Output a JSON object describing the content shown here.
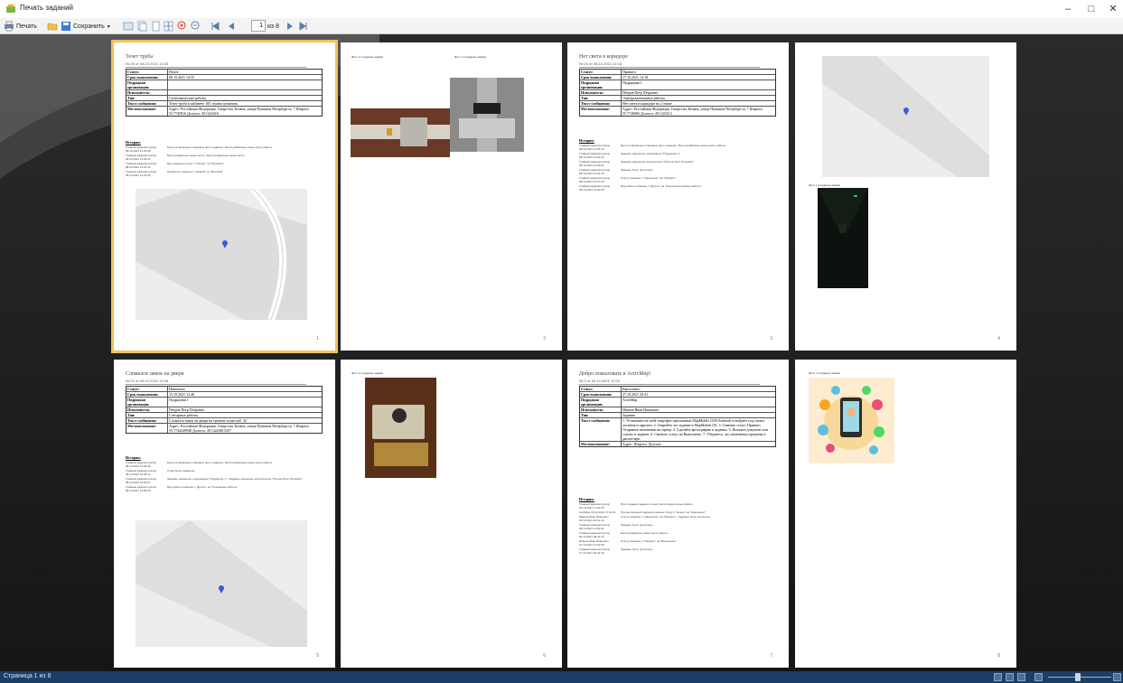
{
  "window": {
    "title": "Печать заданий",
    "controls": {
      "minimize": "–",
      "maximize": "□",
      "close": "✕"
    }
  },
  "toolbar": {
    "print_label": "Печать",
    "save_label": "Сохранить",
    "page_input": "1",
    "page_of": "из 8",
    "icons": [
      "printer-icon",
      "open-folder-icon",
      "save-icon",
      "dropdown-arrow-icon",
      "export-icon",
      "copy-icon",
      "single-page-icon",
      "multi-page-icon",
      "zoom-in-icon",
      "zoom-out-icon",
      "first-page-icon",
      "prev-page-icon",
      "next-page-icon",
      "last-page-icon"
    ]
  },
  "pages": [
    {
      "number": "1",
      "title": "Течет труба",
      "subtitle": "№ 25 от 08.10.2021 14:35",
      "rows": [
        {
          "k": "Статус:",
          "v": "Новое"
        },
        {
          "k": "Срок выполнения:",
          "v": "08.10.2021 14:35"
        },
        {
          "k": "Подрядная организация:",
          "v": ""
        },
        {
          "k": "Исполнитель:",
          "v": ""
        },
        {
          "k": "Тип:",
          "v": "Сантехнические работы"
        },
        {
          "k": "Текст сообщения:",
          "v": "Течет труба в кабинете 105, нужно починить"
        },
        {
          "k": "Местоположение:",
          "v": "Адрес: Российская Федерация, Татарстан, Казань, улица Пушкина Петербургск. 7 Широта: 55.7745816 Долгота: 49.1424416"
        }
      ],
      "history_head": "История:",
      "history": [
        {
          "k": "Главный администратор 08.10.2021 14:35:09",
          "v": "Были установлены плановые фото задания • Были добавлены новые фото работы"
        },
        {
          "k": "Главный администратор 08.10.2021 14:40:31",
          "v": "Были добавлены новые фото • Были добавлены новые фото"
        },
        {
          "k": "Главный администратор 08.10.2021 14:41:12",
          "v": "Был изменен статус с \"Принят\" на \"В работе\""
        },
        {
          "k": "Главный администратор 08.10.2021 14:44:56",
          "v": "Приоритет изменен с \"Низкий\" на \"Высокий\""
        }
      ]
    },
    {
      "number": "2",
      "photo_label_1": "Фото 1 (создание заявки)",
      "photo_label_2": "Фото 2 (создание заявки)"
    },
    {
      "number": "3",
      "title": "Нет света в коридоре",
      "subtitle": "№ 24 от 08.10.2021 14:18",
      "rows": [
        {
          "k": "Статус:",
          "v": "Принято"
        },
        {
          "k": "Срок выполнения:",
          "v": "27.10.2021 14:18"
        },
        {
          "k": "Подрядная организация:",
          "v": "Подрядчик 1"
        },
        {
          "k": "Исполнитель:",
          "v": "Петров Петр Петрович"
        },
        {
          "k": "Тип:",
          "v": "Электромонтажные работы"
        },
        {
          "k": "Текст сообщения:",
          "v": "Нет света в коридоре на 2 этаже"
        },
        {
          "k": "Местоположение:",
          "v": "Адрес: Российская Федерация, Татарстан, Казань, улица Пушкина Петербургск. 7 Широта: 55.7746006 Долгота: 49.1423212"
        }
      ],
      "history_head": "История:",
      "history": [
        {
          "k": "Главный администратор 08.10.2021 14:18:19",
          "v": "Были установлены плановые фото задания • Были добавлены новые фото работы"
        },
        {
          "k": "Главный администратор 08.10.2021 14:19:44",
          "v": "Задание назначено организации \"Подрядчик 1\""
        },
        {
          "k": "Главный администратор 08.10.2021 14:20:01",
          "v": "Задание назначено исполнителю \"Петров Петр Петрович\""
        },
        {
          "k": "Главный администратор 08.10.2021 14:21:15",
          "v": "Задание было прочитано"
        },
        {
          "k": "Главный администратор 08.10.2021 14:27:20",
          "v": "Статус изменен с \"Назначено\" на \"Принято\""
        },
        {
          "k": "Главный администратор 08.10.2021 14:30:08",
          "v": "Вид работы изменен с \"Другое\" на \"Электромонтажные работы\""
        }
      ]
    },
    {
      "number": "4",
      "photo_label": "Фото 1 (создание заявки)"
    },
    {
      "number": "5",
      "title": "Сломался замок на двери",
      "subtitle": "№ 22 от 08.10.2021 13:46",
      "rows": [
        {
          "k": "Статус:",
          "v": "Назначено"
        },
        {
          "k": "Срок выполнения:",
          "v": "15.10.2021 13:46"
        },
        {
          "k": "Подрядная организация:",
          "v": "Подрядчик 1"
        },
        {
          "k": "Исполнитель:",
          "v": "Петров Петр Петрович"
        },
        {
          "k": "Тип:",
          "v": "Слесарные работы"
        },
        {
          "k": "Текст сообщения:",
          "v": "Сломался замок на двери на третьем этаже каб. 32"
        },
        {
          "k": "Местоположение:",
          "v": "Адрес: Российская Федерация, Татарстан, Казань, улица Пушкина Петербургск. 7 Широта: 55.7744249948 Долгота: 49.14224813357"
        }
      ],
      "history_head": "История:",
      "history": [
        {
          "k": "Главный администратор 08.10.2021 13:46:35",
          "v": "Были установлены плановые фото задания • Были добавлены новые фото работы"
        },
        {
          "k": "Главный администратор 08.10.2021 13:48:12",
          "v": "Точка была заменена"
        },
        {
          "k": "Главный администратор 08.10.2021 13:50:27",
          "v": "Задание назначено организации \"Подрядчик 1\" • Задание назначено исполнителю \"Петров Петр Петрович\""
        },
        {
          "k": "Главный администратор 08.10.2021 13:55:03",
          "v": "Вид работы изменен с \"Другое\" на \"Слесарные работы\""
        }
      ]
    },
    {
      "number": "6",
      "photo_label": "Фото 1 (создание заявки)"
    },
    {
      "number": "7",
      "title": "Добро пожаловать в ActivMap!",
      "subtitle": "№ 3 от 04.10.2021 17:00",
      "rows": [
        {
          "k": "Статус:",
          "v": "Выполнено"
        },
        {
          "k": "Срок выполнения:",
          "v": "27.10.2021 20:41"
        },
        {
          "k": "Подрядная организация:",
          "v": "ActivMap"
        },
        {
          "k": "Исполнитель:",
          "v": "Иванов Иван Иванович"
        },
        {
          "k": "Тип:",
          "v": "Задание"
        },
        {
          "k": "Текст сообщения:",
          "v": "1. Установите на свой смартфон приложение MapMobile (iOS/Android) и войдите под своим логином и паролем. 2. Откройте это задание в MapMobile OS. 3. Смените статус Принято. Отправьте изменения на сервер. 4. Сделайте фотографию в задании. 5. Вложите документ или ссылку в задание. 6. Смените статус на Выполнено. 7. Убедитесь, что изменения отражены в диспетчере."
        },
        {
          "k": "Местоположение:",
          "v": "Адрес: Широта: Долгота:"
        }
      ],
      "history_head": "История:",
      "history": [
        {
          "k": "Главный администратор 04.10.2021 17:00:36",
          "v": "При создании задания к нему были прикреплены файлы"
        },
        {
          "k": "ActivMap 04.10.2021 17:04:21",
          "v": "При выполнении задания изменен статус с \"Новое\" на \"Назначено\""
        },
        {
          "k": "Иванов Иван Иванович 05.10.2021 10:12:44",
          "v": "Статус изменен с \"Назначено\" на \"Принято\" • Задание было прочитано"
        },
        {
          "k": "Главный администратор 05.10.2021 11:30:02",
          "v": "Задание было прочитано"
        },
        {
          "k": "Главный администратор 06.10.2021 09:41:17",
          "v": "Были добавлены новые фото работы"
        },
        {
          "k": "Иванов Иван Иванович 07.10.2021 14:22:05",
          "v": "Статус изменен с \"Принято\" на \"Выполнено\""
        },
        {
          "k": "Главный администратор 27.10.2021 20:41:33",
          "v": "Задание было прочитано"
        }
      ]
    },
    {
      "number": "8",
      "photo_label": "Фото 1 (создание заявки)"
    }
  ],
  "statusbar": {
    "text": "Страница 1 из 8"
  },
  "colors": {
    "selection": "#f0c25a",
    "statusbar": "#1b3e66",
    "preview_bg": "#1e1e1e",
    "map_pin": "#3b5bd6"
  }
}
